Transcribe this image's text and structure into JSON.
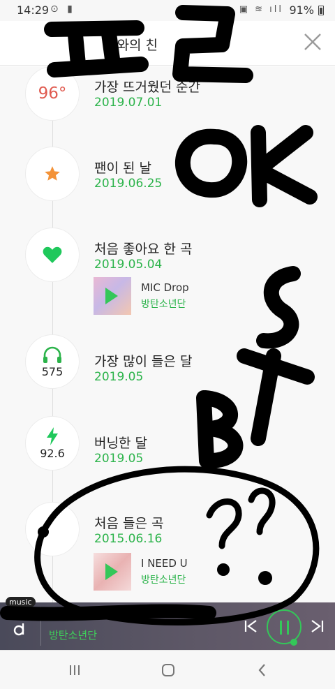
{
  "status_bar": {
    "time": "14:29",
    "battery": "91%"
  },
  "header": {
    "title": "나와의 친",
    "close_icon": "close-icon"
  },
  "entries": [
    {
      "badge_text": "96°",
      "label": "가장 뜨거웠던 순간",
      "date": "2019.07.01",
      "icon": "temperature-text"
    },
    {
      "label": "팬이 된 날",
      "date": "2019.06.25",
      "icon": "star-icon",
      "icon_color": "#f39237"
    },
    {
      "label": "처음 좋아요 한 곡",
      "date": "2019.05.04",
      "icon": "heart-icon",
      "icon_color": "#1fc85b",
      "song": {
        "title": "MIC Drop",
        "artist": "방탄소년단"
      }
    },
    {
      "badge_number": "575",
      "label": "가장 많이 들은 달",
      "date": "2019.05",
      "icon": "headphones-icon"
    },
    {
      "badge_number": "92.6",
      "label": "버닝한 달",
      "date": "2019.05",
      "icon": "lightning-icon"
    },
    {
      "label": "처음 들은 곡",
      "date": "2015.06.16",
      "song": {
        "title": "I NEED U",
        "artist": "방탄소년단"
      }
    }
  ],
  "player": {
    "tag": "music",
    "artist": "방탄소년단",
    "accent": "#34c759"
  },
  "colors": {
    "green": "#2bb34a",
    "red": "#e05a4f",
    "orange": "#f39237"
  }
}
